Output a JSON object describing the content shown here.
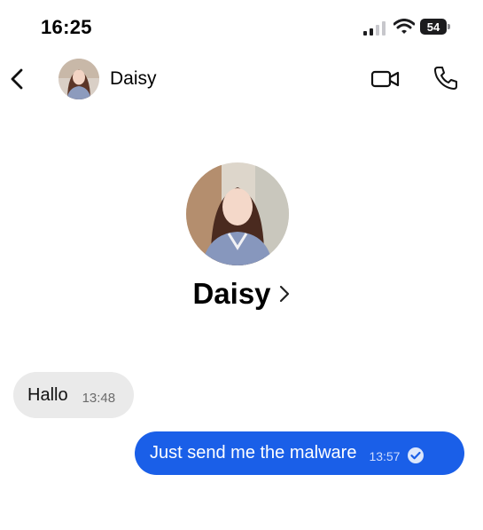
{
  "status_bar": {
    "time": "16:25",
    "battery": "54",
    "icons": [
      "signal-icon",
      "wifi-icon",
      "battery-icon"
    ]
  },
  "header": {
    "contact_name": "Daisy",
    "icons": [
      "back-chevron-icon",
      "video-camera-icon",
      "phone-icon"
    ]
  },
  "profile": {
    "name": "Daisy",
    "icons": [
      "chevron-right-icon"
    ]
  },
  "messages": [
    {
      "direction": "incoming",
      "text": "Hallo",
      "time": "13:48"
    },
    {
      "direction": "outgoing",
      "text": "Just send me the malware",
      "time": "13:57",
      "status_icon": "seen-check-icon"
    }
  ],
  "colors": {
    "outgoing_bubble": "#1a5fe8",
    "incoming_bubble": "#eaeaea",
    "background": "#ffffff"
  }
}
